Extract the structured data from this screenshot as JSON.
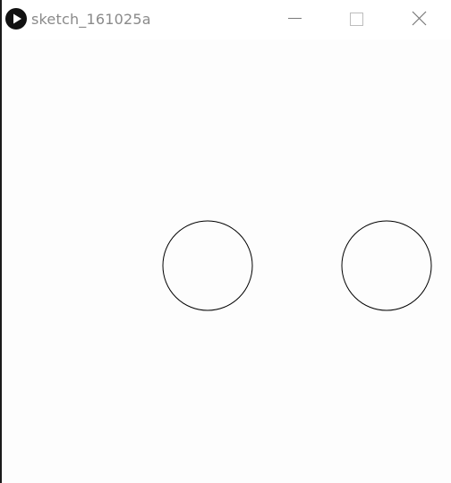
{
  "window": {
    "title": "sketch_161025a",
    "icons": {
      "app": "processing-play-icon",
      "minimize": "minimize-icon",
      "maximize": "maximize-icon",
      "close": "close-icon"
    }
  },
  "sketch": {
    "background": "#fdfdfd",
    "stroke": "#000000",
    "fill": "none",
    "shapes": [
      "circle",
      "circle"
    ]
  }
}
